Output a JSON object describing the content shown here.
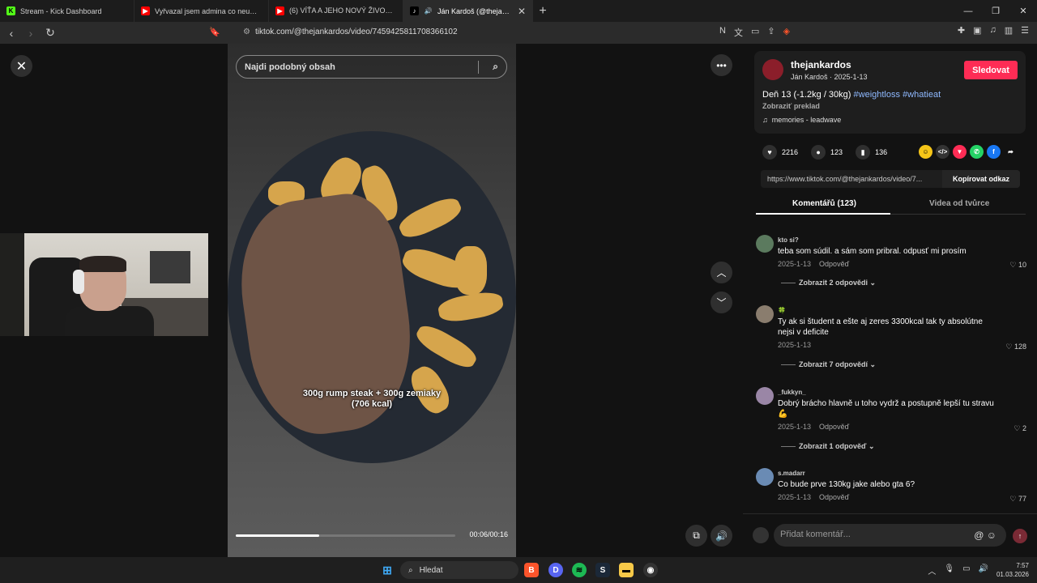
{
  "browser": {
    "tabs": [
      {
        "title": "Stream - Kick Dashboard",
        "fav": "K",
        "favcolor": "#53fc18",
        "active": false
      },
      {
        "title": "Vyřvazal jsem admina co neumí prav",
        "fav": "▶",
        "favcolor": "#ff0000",
        "active": false
      },
      {
        "title": "(6) VÍŤA A JEHO NOVÝ ŽIVOT 🍪 - Yo",
        "fav": "▶",
        "favcolor": "#ff0000",
        "active": false
      },
      {
        "title": "Ján Kardoš (@thejankardos) |",
        "fav": "♪",
        "favcolor": "#000000",
        "active": true
      }
    ],
    "url": "tiktok.com/@thejankardos/video/7459425811708366102"
  },
  "video": {
    "search_placeholder": "Najdi podobný obsah",
    "caption_line1": "300g rump steak + 300g zemiaky",
    "caption_line2": "(706 kcal)",
    "time": "00:06/00:16",
    "progress": 0.38
  },
  "post": {
    "username": "thejankardos",
    "subtitle": "Ján Kardoš · 2025-1-13",
    "follow_label": "Sledovat",
    "description": "Deň 13 (-1.2kg / 30kg)",
    "tag1": "#weightloss",
    "tag2": "#whatieat",
    "translate": "Zobraziť preklad",
    "music": "memories - leadwave",
    "likes": "2216",
    "comments": "123",
    "saves": "136",
    "link": "https://www.tiktok.com/@thejankardos/video/7...",
    "copy_label": "Kopírovat odkaz",
    "tab_comments": "Komentářů (123)",
    "tab_videos": "Videa od tvůrce"
  },
  "comments": [
    {
      "user": "kto si?",
      "text": "teba som súdil. a sám som pribral. odpusť mi prosím",
      "date": "2025-1-13",
      "reply": "Odpověď",
      "likes": "10",
      "more": "Zobrazit 2 odpovědi"
    },
    {
      "user": "🍀",
      "text": "Ty ak si študent a ešte aj zeres 3300kcal tak ty absolútne nejsi v deficite",
      "date": "2025-1-13",
      "reply": "Odpověď",
      "likes": "128",
      "more": "Zobrazit 7 odpovědí"
    },
    {
      "user": "_fukkyn_",
      "text": "Dobrý brácho hlavně u toho vydrž a postupně lepší tu stravu💪",
      "date": "2025-1-13",
      "reply": "Odpověď",
      "likes": "2",
      "more": "Zobrazit 1 odpověď"
    },
    {
      "user": "s.madarr",
      "text": "Co bude prve 130kg jake alebo gta 6?",
      "date": "2025-1-13",
      "reply": "Odpověď",
      "likes": "77",
      "more": ""
    }
  ],
  "comment_input": {
    "placeholder": "Přidat komentář..."
  },
  "taskbar": {
    "search": "Hledat",
    "time": "7:57",
    "date": "01.03.2026"
  }
}
